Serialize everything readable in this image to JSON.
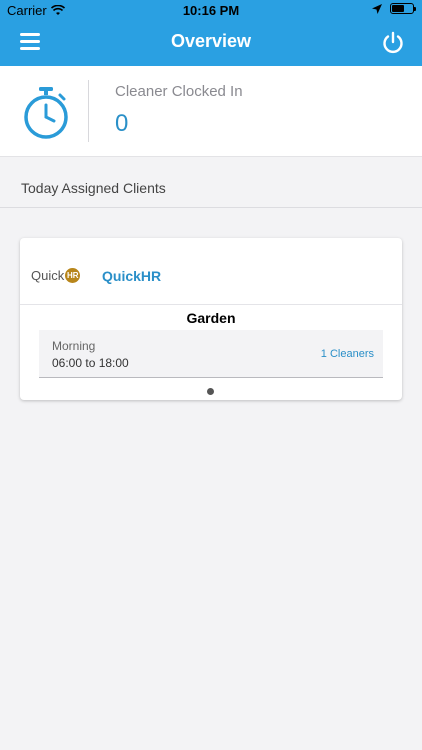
{
  "status_bar": {
    "carrier": "Carrier",
    "time": "10:16 PM"
  },
  "nav": {
    "title": "Overview",
    "menu_icon": "hamburger-menu-icon",
    "power_icon": "power-icon"
  },
  "clocked": {
    "label": "Cleaner Clocked In",
    "count": "0",
    "icon": "stopwatch-icon"
  },
  "section": {
    "title": "Today Assigned Clients"
  },
  "client_card": {
    "logo_text": "Quick",
    "logo_badge": "HR",
    "brand": "QuickHR",
    "site": "Garden",
    "shift": {
      "name": "Morning",
      "hours": "06:00 to 18:00",
      "cleaners": "1  Cleaners"
    }
  },
  "colors": {
    "accent": "#2aa0e2",
    "link": "#2a8fc8",
    "background": "#f3f3f5"
  }
}
